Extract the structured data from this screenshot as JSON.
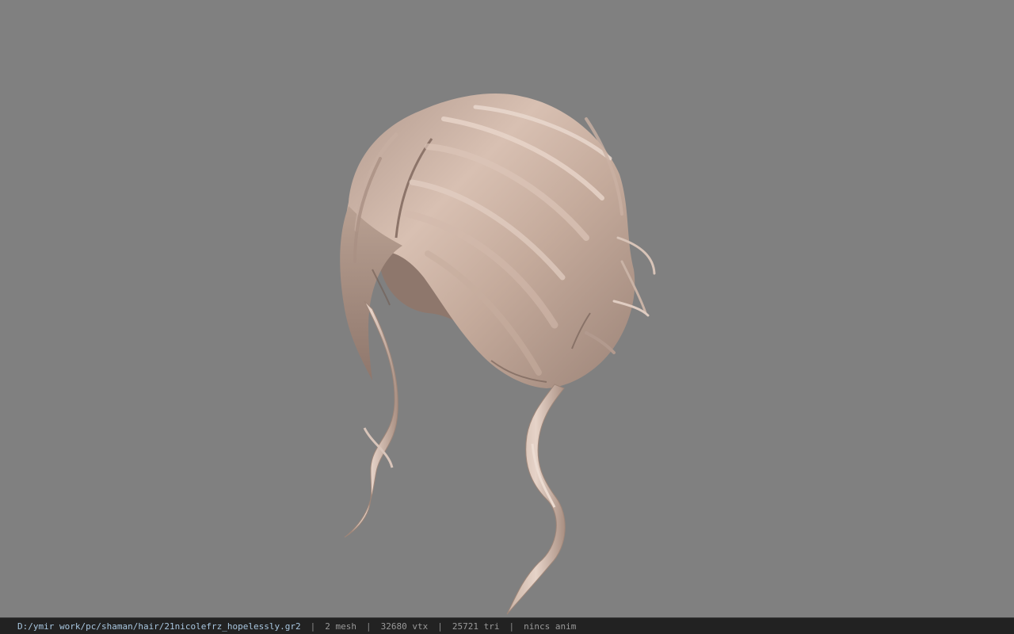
{
  "viewer": {
    "background_color": "#808080",
    "model_subject": "3D hair mesh"
  },
  "status_bar": {
    "file_path": "D:/ymir work/pc/shaman/hair/21nicolefrz_hopelessly.gr2",
    "separator": "|",
    "mesh_count": "2 mesh",
    "vertex_count": "32680 vtx",
    "triangle_count": "25721 tri",
    "anim_status": "nincs anim"
  }
}
